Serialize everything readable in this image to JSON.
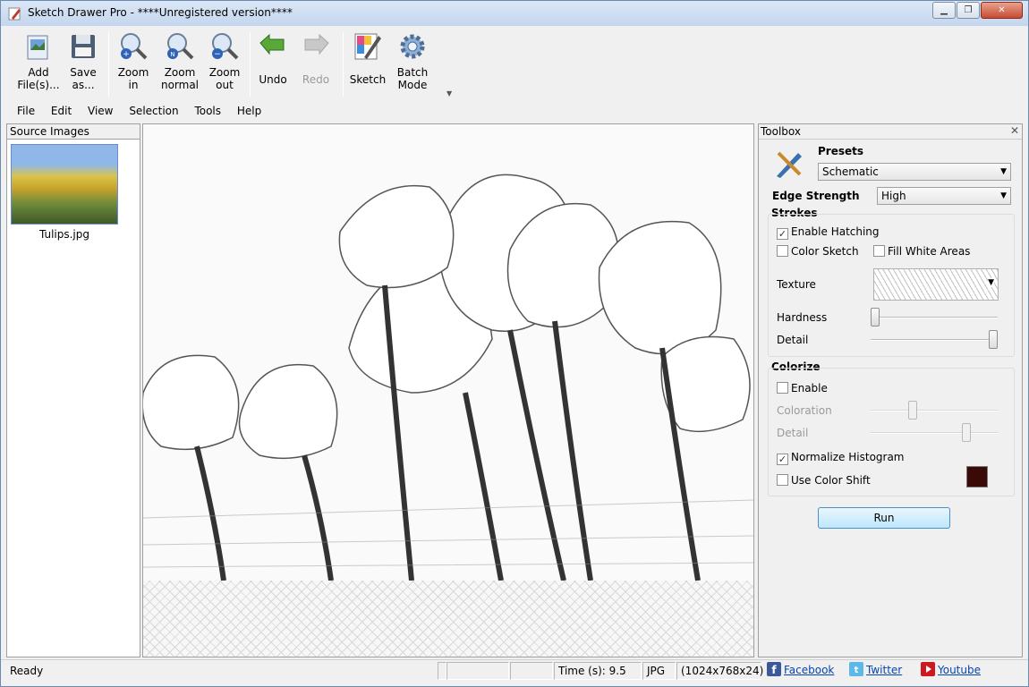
{
  "window": {
    "title": "Sketch Drawer Pro - ****Unregistered version****"
  },
  "toolbar": {
    "add_files": "Add\nFile(s)...",
    "save_as": "Save\nas...",
    "zoom_in": "Zoom\nin",
    "zoom_normal": "Zoom\nnormal",
    "zoom_out": "Zoom\nout",
    "undo": "Undo",
    "redo": "Redo",
    "sketch": "Sketch",
    "batch_mode": "Batch\nMode"
  },
  "menu": {
    "file": "File",
    "edit": "Edit",
    "view": "View",
    "selection": "Selection",
    "tools": "Tools",
    "help": "Help"
  },
  "source_panel": {
    "title": "Source Images",
    "items": [
      {
        "filename": "Tulips.jpg"
      }
    ]
  },
  "toolbox": {
    "title": "Toolbox",
    "presets_label": "Presets",
    "preset_value": "Schematic",
    "edge_strength_label": "Edge Strength",
    "edge_strength_value": "High",
    "strokes": {
      "title": "Strokes",
      "enable_hatching": {
        "label": "Enable Hatching",
        "checked": true
      },
      "color_sketch": {
        "label": "Color Sketch",
        "checked": false
      },
      "fill_white_areas": {
        "label": "Fill White Areas",
        "checked": false
      },
      "texture_label": "Texture",
      "hardness_label": "Hardness",
      "hardness_value": 0,
      "detail_label": "Detail",
      "detail_value": 1.0
    },
    "colorize": {
      "title": "Colorize",
      "enable": {
        "label": "Enable",
        "checked": false
      },
      "coloration_label": "Coloration",
      "coloration_value": 0.32,
      "detail_label": "Detail",
      "detail_value": 0.76,
      "normalize_histogram": {
        "label": "Normalize Histogram",
        "checked": true
      },
      "use_color_shift": {
        "label": "Use Color Shift",
        "checked": false
      },
      "color_shift_color": "#3a0a06"
    },
    "run_label": "Run"
  },
  "statusbar": {
    "status": "Ready",
    "time": "Time (s): 9.5",
    "format": "JPG",
    "dimensions": "(1024x768x24)",
    "facebook": "Facebook",
    "twitter": "Twitter",
    "youtube": "Youtube"
  },
  "colors": {
    "title_bar": "#c4d6ee",
    "run_button": "#bde6fd",
    "link": "#0645ad"
  }
}
